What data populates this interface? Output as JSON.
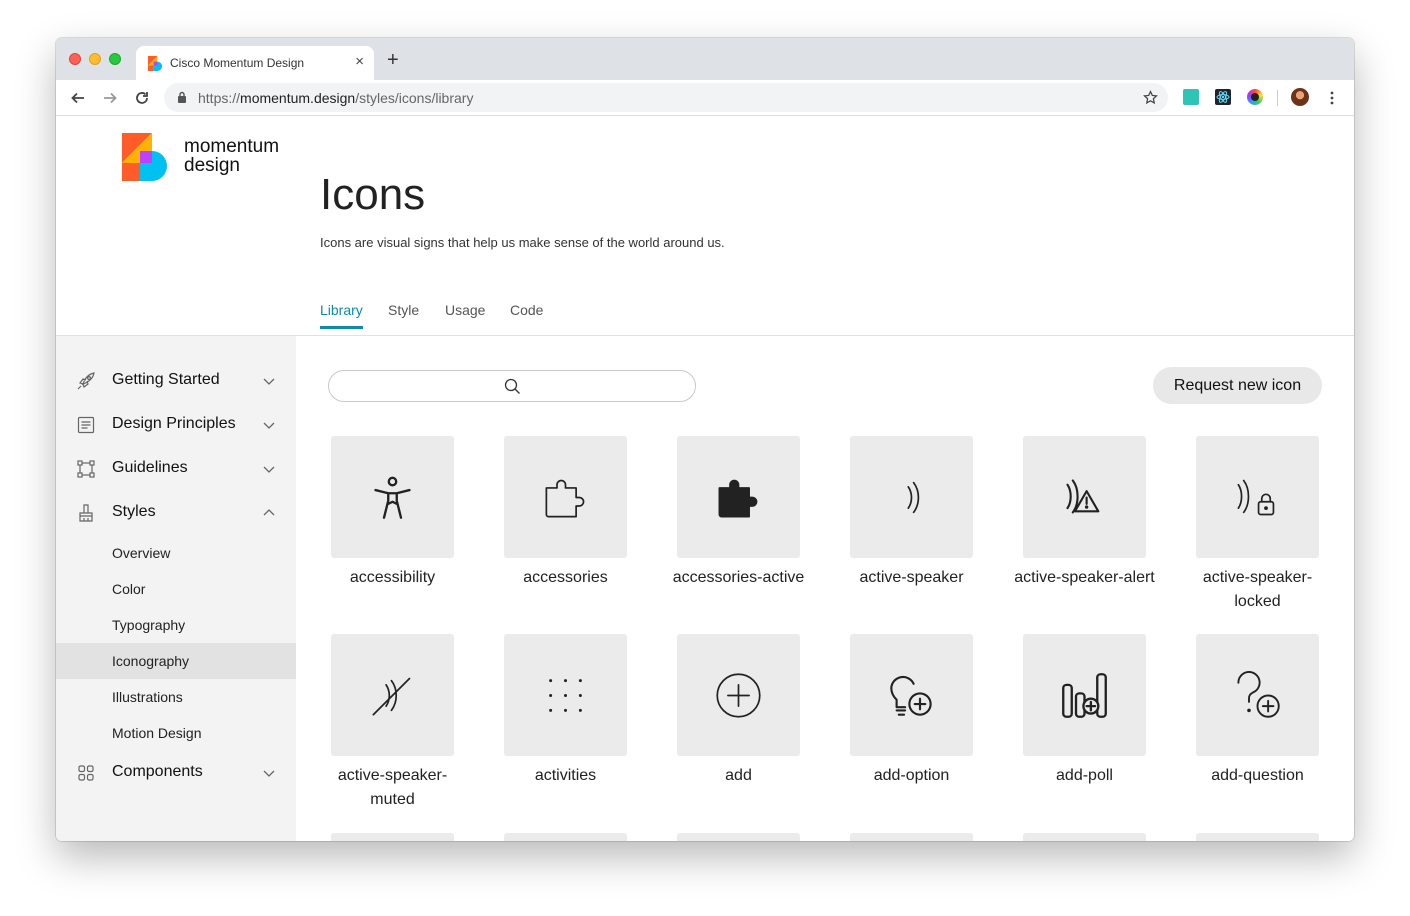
{
  "browser": {
    "tab_title": "Cisco Momentum Design",
    "tab_close": "×",
    "new_tab": "+",
    "url_scheme": "https://",
    "url_host": "momentum.design",
    "url_path": "/styles/icons/library"
  },
  "site": {
    "logo_line1": "momentum",
    "logo_line2": "design"
  },
  "page": {
    "title": "Icons",
    "description": "Icons are visual signs that help us make sense of the world around us.",
    "tabs": [
      "Library",
      "Style",
      "Usage",
      "Code"
    ],
    "active_tab": "Library"
  },
  "sidebar": {
    "items": [
      {
        "label": "Getting Started",
        "icon": "rocket-icon",
        "expanded": false
      },
      {
        "label": "Design Principles",
        "icon": "document-icon",
        "expanded": false
      },
      {
        "label": "Guidelines",
        "icon": "frame-icon",
        "expanded": false
      },
      {
        "label": "Styles",
        "icon": "brush-icon",
        "expanded": true
      },
      {
        "label": "Components",
        "icon": "grid-icon",
        "expanded": false
      }
    ],
    "styles_children": [
      "Overview",
      "Color",
      "Typography",
      "Iconography",
      "Illustrations",
      "Motion Design"
    ],
    "selected_child": "Iconography"
  },
  "library": {
    "search_placeholder": "",
    "request_button": "Request new icon",
    "icons": [
      {
        "name": "accessibility",
        "label_lines": [
          "accessibility"
        ]
      },
      {
        "name": "accessories",
        "label_lines": [
          "accessories"
        ]
      },
      {
        "name": "accessories-active",
        "label_lines": [
          "accessories-active"
        ]
      },
      {
        "name": "active-speaker",
        "label_lines": [
          "active-speaker"
        ]
      },
      {
        "name": "active-speaker-alert",
        "label_lines": [
          "active-speaker-alert"
        ]
      },
      {
        "name": "active-speaker-locked",
        "label_lines": [
          "active-speaker-",
          "locked"
        ]
      },
      {
        "name": "active-speaker-muted",
        "label_lines": [
          "active-speaker-",
          "muted"
        ]
      },
      {
        "name": "activities",
        "label_lines": [
          "activities"
        ]
      },
      {
        "name": "add",
        "label_lines": [
          "add"
        ]
      },
      {
        "name": "add-option",
        "label_lines": [
          "add-option"
        ]
      },
      {
        "name": "add-poll",
        "label_lines": [
          "add-poll"
        ]
      },
      {
        "name": "add-question",
        "label_lines": [
          "add-question"
        ]
      }
    ]
  },
  "colors": {
    "accent": "#0c8bb0",
    "tile": "#ebebeb",
    "sidebar": "#f3f3f3",
    "selected": "#e2e2e2"
  }
}
